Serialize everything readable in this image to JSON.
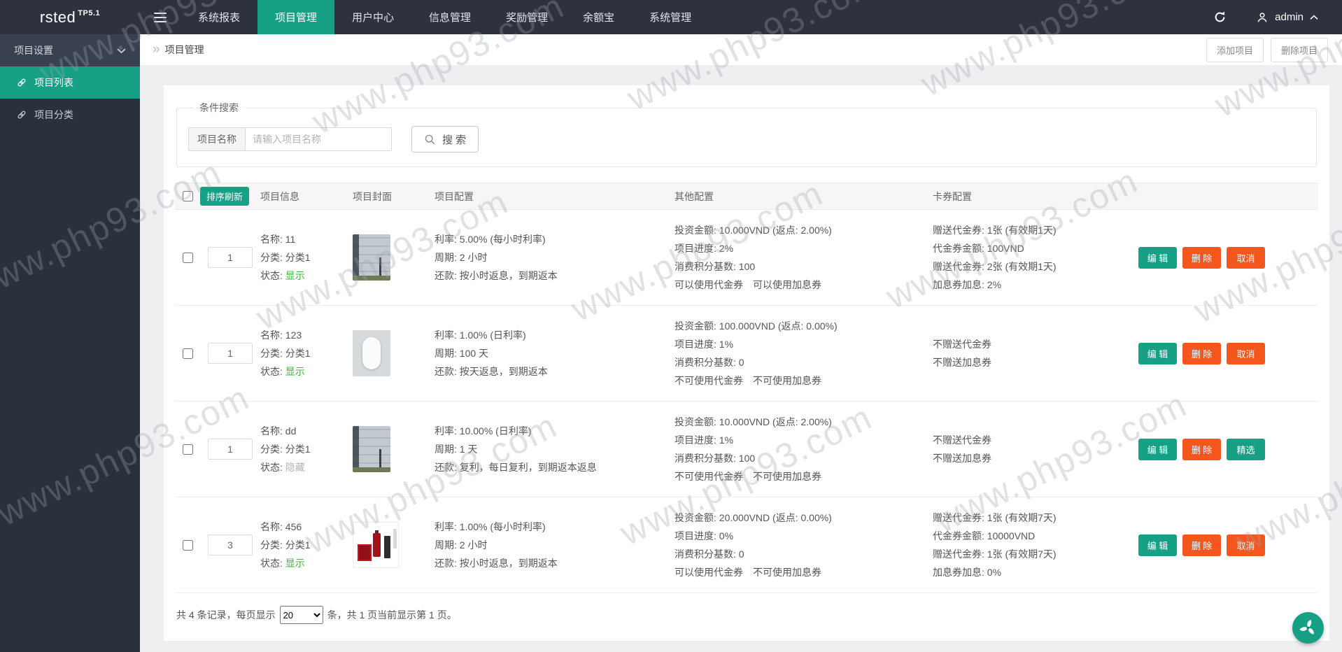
{
  "colors": {
    "accent": "#16A085",
    "danger": "#F4561E",
    "topbar_bg": "#2D323E",
    "sidebar_bg": "#2B313C",
    "status_show": "#3CB93C",
    "status_hide": "#B5B5B5"
  },
  "watermark": "www.php93.com",
  "topbar": {
    "logo": "rsted",
    "logo_sup": "TP5.1",
    "nav": [
      {
        "label": "系统报表",
        "active": false
      },
      {
        "label": "项目管理",
        "active": true
      },
      {
        "label": "用户中心",
        "active": false
      },
      {
        "label": "信息管理",
        "active": false
      },
      {
        "label": "奖励管理",
        "active": false
      },
      {
        "label": "余额宝",
        "active": false
      },
      {
        "label": "系统管理",
        "active": false
      }
    ],
    "username": "admin"
  },
  "sidebar": {
    "group_label": "项目设置",
    "items": [
      {
        "label": "项目列表",
        "active": true
      },
      {
        "label": "项目分类",
        "active": false
      }
    ]
  },
  "page": {
    "breadcrumb": "项目管理",
    "add_button": "添加项目",
    "delete_button": "删除项目"
  },
  "search": {
    "legend": "条件搜索",
    "field_label": "项目名称",
    "placeholder": "请输入项目名称",
    "button_label": "搜 索"
  },
  "table": {
    "sort_refresh_label": "排序刷新",
    "headers": [
      "项目信息",
      "项目封面",
      "项目配置",
      "其他配置",
      "卡券配置"
    ],
    "rows": [
      {
        "sort": "1",
        "cover": "building",
        "info": {
          "name": "名称: 11",
          "category": "分类: 分类1",
          "status_label": "状态: ",
          "status": "显示",
          "status_type": "show"
        },
        "config": [
          "利率: 5.00% (每小时利率)",
          "周期: 2 小时",
          "还款: 按小时返息，到期返本"
        ],
        "other": [
          "投资金额: 10.000VND (返点: 2.00%)",
          "项目进度: 2%",
          "消费积分基数: 100",
          "可以使用代金券　可以使用加息券"
        ],
        "coupon": [
          "赠送代金券: 1张 (有效期1天)",
          "代金券金额: 100VND",
          "赠送代金券: 2张 (有效期1天)",
          "加息券加息: 2%"
        ],
        "buttons": [
          {
            "label": "编 辑",
            "style": "primary",
            "name": "edit-button"
          },
          {
            "label": "删 除",
            "style": "danger",
            "name": "delete-button"
          },
          {
            "label": "取消",
            "style": "danger",
            "name": "cancel-button"
          }
        ]
      },
      {
        "sort": "1",
        "cover": "cylinder",
        "info": {
          "name": "名称: 123",
          "category": "分类: 分类1",
          "status_label": "状态: ",
          "status": "显示",
          "status_type": "show"
        },
        "config": [
          "利率: 1.00% (日利率)",
          "周期: 100 天",
          "还款: 按天返息，到期返本"
        ],
        "other": [
          "投资金额: 100.000VND (返点: 0.00%)",
          "项目进度: 1%",
          "消费积分基数: 0",
          "不可使用代金券　不可使用加息券"
        ],
        "coupon": [
          "不赠送代金券",
          "不赠送加息券"
        ],
        "buttons": [
          {
            "label": "编 辑",
            "style": "primary",
            "name": "edit-button"
          },
          {
            "label": "删 除",
            "style": "danger",
            "name": "delete-button"
          },
          {
            "label": "取消",
            "style": "danger",
            "name": "cancel-button"
          }
        ]
      },
      {
        "sort": "1",
        "cover": "building",
        "info": {
          "name": "名称: dd",
          "category": "分类: 分类1",
          "status_label": "状态: ",
          "status": "隐藏",
          "status_type": "hide"
        },
        "config": [
          "利率: 10.00% (日利率)",
          "周期: 1 天",
          "还款: 复利，每日复利，到期返本返息"
        ],
        "other": [
          "投资金额: 10.000VND (返点: 2.00%)",
          "项目进度: 1%",
          "消费积分基数: 100",
          "不可使用代金券　不可使用加息券"
        ],
        "coupon": [
          "不赠送代金券",
          "不赠送加息券"
        ],
        "buttons": [
          {
            "label": "编 辑",
            "style": "primary",
            "name": "edit-button"
          },
          {
            "label": "删 除",
            "style": "danger",
            "name": "delete-button"
          },
          {
            "label": "精选",
            "style": "primary",
            "name": "featured-button"
          }
        ]
      },
      {
        "sort": "3",
        "cover": "product",
        "info": {
          "name": "名称: 456",
          "category": "分类: 分类1",
          "status_label": "状态: ",
          "status": "显示",
          "status_type": "show"
        },
        "config": [
          "利率: 1.00% (每小时利率)",
          "周期: 2 小时",
          "还款: 按小时返息，到期返本"
        ],
        "other": [
          "投资金额: 20.000VND (返点: 0.00%)",
          "项目进度: 0%",
          "消费积分基数: 0",
          "可以使用代金券　不可使用加息券"
        ],
        "coupon": [
          "赠送代金券: 1张 (有效期7天)",
          "代金券金额: 10000VND",
          "赠送代金券: 1张 (有效期7天)",
          "加息券加息: 0%"
        ],
        "buttons": [
          {
            "label": "编 辑",
            "style": "primary",
            "name": "edit-button"
          },
          {
            "label": "删 除",
            "style": "danger",
            "name": "delete-button"
          },
          {
            "label": "取消",
            "style": "danger",
            "name": "cancel-button"
          }
        ]
      }
    ]
  },
  "pagination": {
    "prefix": "共 4 条记录，每页显示",
    "page_size": "20",
    "suffix": "条，共 1 页当前显示第 1 页。"
  }
}
